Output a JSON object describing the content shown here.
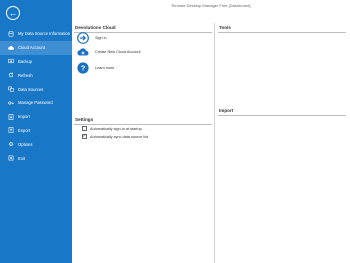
{
  "window": {
    "title": "Remote Desktop Manager Free [Dashboard]"
  },
  "sidebar": {
    "items": [
      {
        "label": "My Data Source Information",
        "icon": "database-icon",
        "selected": false
      },
      {
        "label": "Cloud Account",
        "icon": "cloud-icon",
        "selected": true
      },
      {
        "label": "Backup",
        "icon": "backup-icon",
        "selected": false
      },
      {
        "label": "Refresh",
        "icon": "refresh-icon",
        "selected": false
      },
      {
        "label": "Data Sources",
        "icon": "data-sources-icon",
        "selected": false
      },
      {
        "label": "Manage Password",
        "icon": "key-icon",
        "selected": false
      },
      {
        "label": "Import",
        "icon": "import-icon",
        "selected": false
      },
      {
        "label": "Export",
        "icon": "export-icon",
        "selected": false
      },
      {
        "label": "Options",
        "icon": "options-icon",
        "selected": false
      },
      {
        "label": "Exit",
        "icon": "exit-icon",
        "selected": false
      }
    ]
  },
  "cloud": {
    "title": "Devolutions Cloud",
    "items": [
      {
        "label": "Sign in",
        "icon": "sign-in-icon"
      },
      {
        "label": "Create New Cloud Account",
        "icon": "create-cloud-icon"
      },
      {
        "label": "Learn more",
        "icon": "help-icon"
      }
    ]
  },
  "settings": {
    "title": "Settings",
    "options": [
      {
        "label": "Automatically sign-in at startup",
        "checked": false
      },
      {
        "label": "Automatically sync data source list",
        "checked": true
      }
    ]
  },
  "tools": {
    "title": "Tools"
  },
  "import": {
    "title": "Import"
  },
  "colors": {
    "sidebar": "#1977c7",
    "selected": "#3f8fd4",
    "accent": "#1d6fbf"
  }
}
